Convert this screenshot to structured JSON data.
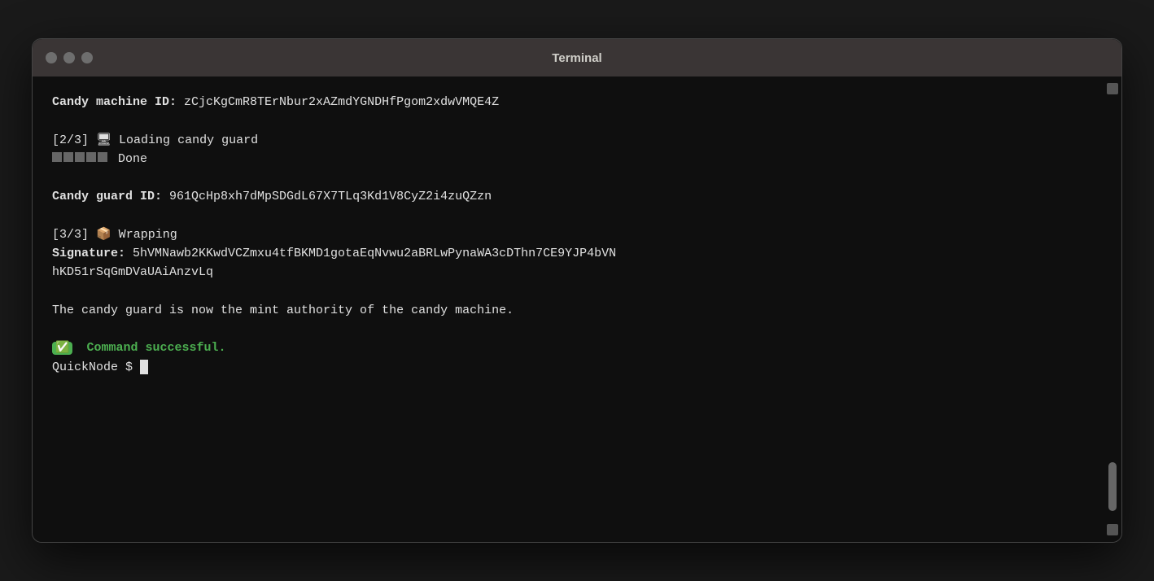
{
  "window": {
    "title": "Terminal",
    "controls": {
      "close": "close",
      "minimize": "minimize",
      "maximize": "maximize"
    }
  },
  "terminal": {
    "lines": [
      {
        "id": "candy-machine-id-label",
        "type": "bold-value",
        "bold_part": "Candy machine ID:",
        "value_part": " zCjcKgCmR8TErNbur2xAZmdYGNDHfPgom2xdwVMQE4Z"
      },
      {
        "id": "blank1",
        "type": "blank"
      },
      {
        "id": "loading-step",
        "type": "step",
        "text": "[2/3] 🖥 Loading candy guard"
      },
      {
        "id": "progress",
        "type": "progress",
        "text": " Done"
      },
      {
        "id": "blank2",
        "type": "blank"
      },
      {
        "id": "candy-guard-id-label",
        "type": "bold-value",
        "bold_part": "Candy guard ID:",
        "value_part": " 961QcHp8xh7dMpSDGdL67X7TLq3Kd1V8CyZ2i4zuQZzn"
      },
      {
        "id": "blank3",
        "type": "blank"
      },
      {
        "id": "wrapping-step",
        "type": "step",
        "text": "[3/3] 📦 Wrapping"
      },
      {
        "id": "signature-line",
        "type": "bold-value",
        "bold_part": "Signature:",
        "value_part": " 5hVMNawb2KKwdVCZmxu4tfBKMD1gotaEqNvwu2aBRLwPynaWA3cDThn7CE9YJP4bVN"
      },
      {
        "id": "signature-line2",
        "type": "plain",
        "text": "hKD51rSqGmDVaUAiAnzvLq"
      },
      {
        "id": "blank4",
        "type": "blank"
      },
      {
        "id": "authority-message",
        "type": "plain",
        "text": "The candy guard is now the mint authority of the candy machine."
      },
      {
        "id": "blank5",
        "type": "blank"
      },
      {
        "id": "success-line",
        "type": "success",
        "badge_text": "✅",
        "text": "Command successful."
      },
      {
        "id": "prompt-line",
        "type": "prompt",
        "prompt": "QuickNode $"
      }
    ]
  }
}
